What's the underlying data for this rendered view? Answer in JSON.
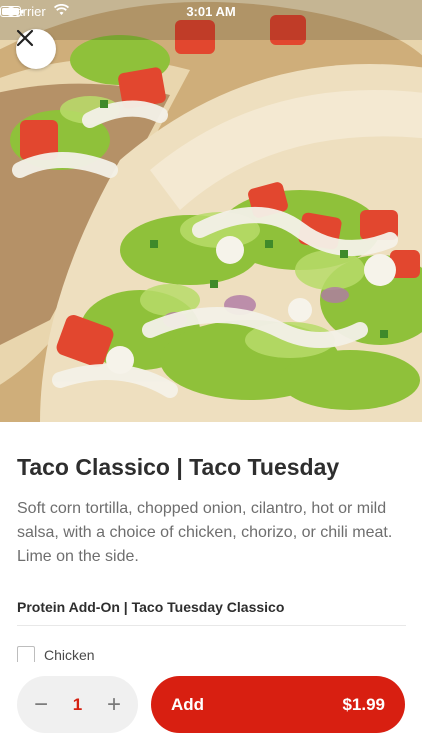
{
  "status_bar": {
    "carrier": "Carrier",
    "time": "3:01 AM"
  },
  "hero": {
    "image": "tacos-photo",
    "close_icon": "close-icon"
  },
  "item": {
    "title": "Taco Classico | Taco Tuesday",
    "description": "Soft corn tortilla, chopped onion, cilantro, hot or mild salsa, with a choice of chicken, chorizo, or chili meat. Lime on the side."
  },
  "addon_section": {
    "title": "Protein Add-On | Taco Tuesday Classico",
    "options": [
      {
        "label": "Chicken",
        "checked": false
      }
    ]
  },
  "cart": {
    "minus_symbol": "−",
    "quantity": "1",
    "plus_symbol": "+",
    "add_label": "Add",
    "price": "$1.99"
  },
  "colors": {
    "accent": "#d81f11",
    "quantity_text": "#d42011"
  }
}
